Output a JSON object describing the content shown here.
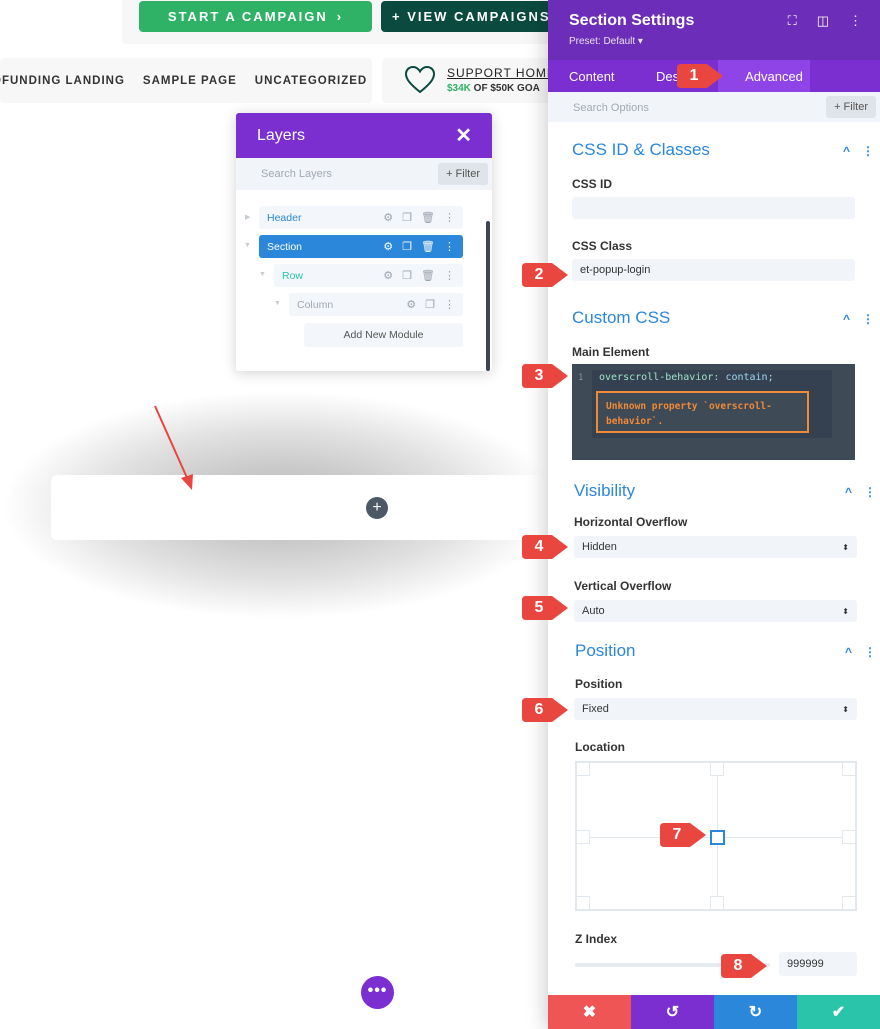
{
  "page": {
    "start_campaign": "START A CAMPAIGN",
    "start_campaign_arrow": "›",
    "view_campaigns": "+ VIEW CAMPAIGNS",
    "nav_items": [
      "OFUNDING LANDING",
      "SAMPLE PAGE",
      "UNCATEGORIZED"
    ],
    "support_title": "SUPPORT HOME",
    "support_amount": "$34K",
    "support_rest": " OF $50K GOA",
    "add_icon": "+",
    "more_icon": "•••"
  },
  "layers": {
    "title": "Layers",
    "close": "✕",
    "search_placeholder": "Search Layers",
    "filter": "+ Filter",
    "items": [
      {
        "label": "Header"
      },
      {
        "label": "Section"
      },
      {
        "label": "Row"
      },
      {
        "label": "Column"
      }
    ],
    "add_module": "Add New Module"
  },
  "settings": {
    "title": "Section Settings",
    "preset": "Preset: Default ▾",
    "tabs": [
      "Content",
      "Des",
      "Advanced"
    ],
    "search_placeholder": "Search Options",
    "filter": "+ Filter",
    "css_section": "CSS ID & Classes",
    "css_id_label": "CSS ID",
    "css_id_value": "",
    "css_class_label": "CSS Class",
    "css_class_value": "et-popup-login",
    "custom_css_section": "Custom CSS",
    "main_element_label": "Main Element",
    "code_line_number": "1",
    "code_property": "overscroll-behavior",
    "code_colon": ": ",
    "code_value": "contain",
    "code_semicolon": ";",
    "code_error": "Unknown property `overscroll-behavior`.",
    "visibility_section": "Visibility",
    "h_overflow_label": "Horizontal Overflow",
    "h_overflow_value": "Hidden",
    "v_overflow_label": "Vertical Overflow",
    "v_overflow_value": "Auto",
    "position_section": "Position",
    "position_label": "Position",
    "position_value": "Fixed",
    "location_label": "Location",
    "location_selected": "center",
    "z_index_label": "Z Index",
    "z_index_value": "999999",
    "section_toggle": "^",
    "section_more": "⋮",
    "select_arrow": "⬍",
    "bottom": {
      "cancel": "✖",
      "undo": "↺",
      "redo": "↻",
      "save": "✔"
    }
  },
  "callouts": [
    "1",
    "2",
    "3",
    "4",
    "5",
    "6",
    "7",
    "8"
  ],
  "colors": {
    "purple": "#7b2fd0",
    "blue": "#2b87da",
    "green": "#2fb265",
    "callout_red": "#e8463e"
  }
}
